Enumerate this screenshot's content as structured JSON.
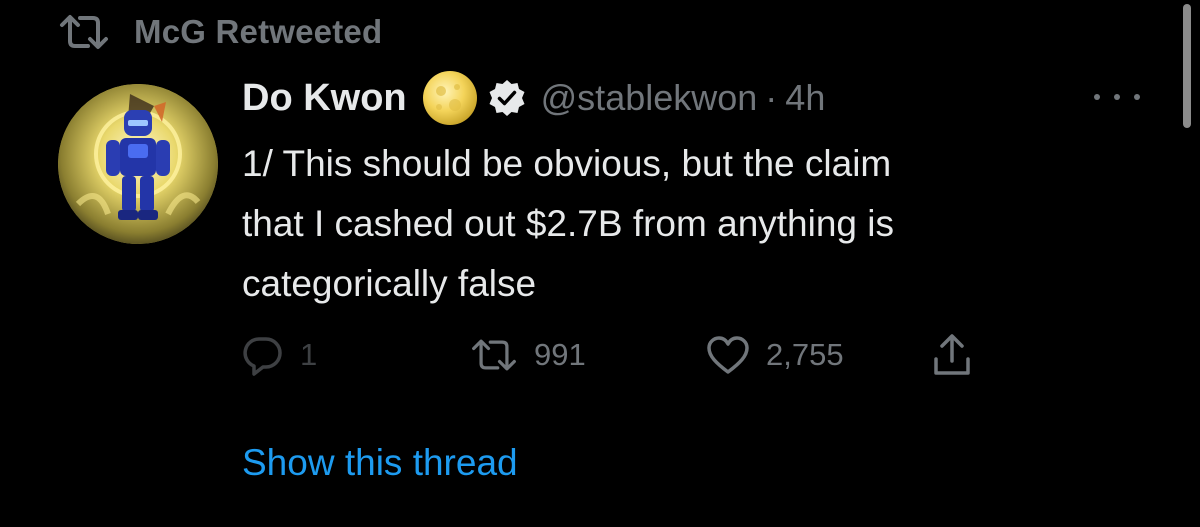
{
  "social_context": {
    "label": "McG Retweeted",
    "icon": "retweet-icon"
  },
  "tweet": {
    "author": {
      "display_name": "Do Kwon",
      "name_emoji": "moon-emoji",
      "verified_badge": "verified-badge-icon",
      "handle": "@stablekwon",
      "separator": "·",
      "time": "4h"
    },
    "text_lines": [
      "1/ This should be obvious, but the claim",
      "that I cashed out $2.7B from anything is",
      "categorically false"
    ],
    "actions": {
      "reply_count": "1",
      "retweet_count": "991",
      "like_count": "2,755"
    },
    "show_thread_label": "Show this thread"
  },
  "colors": {
    "background": "#000000",
    "primary_text": "#e7e9ea",
    "secondary_text": "#71767b",
    "link": "#1d9bf0"
  }
}
